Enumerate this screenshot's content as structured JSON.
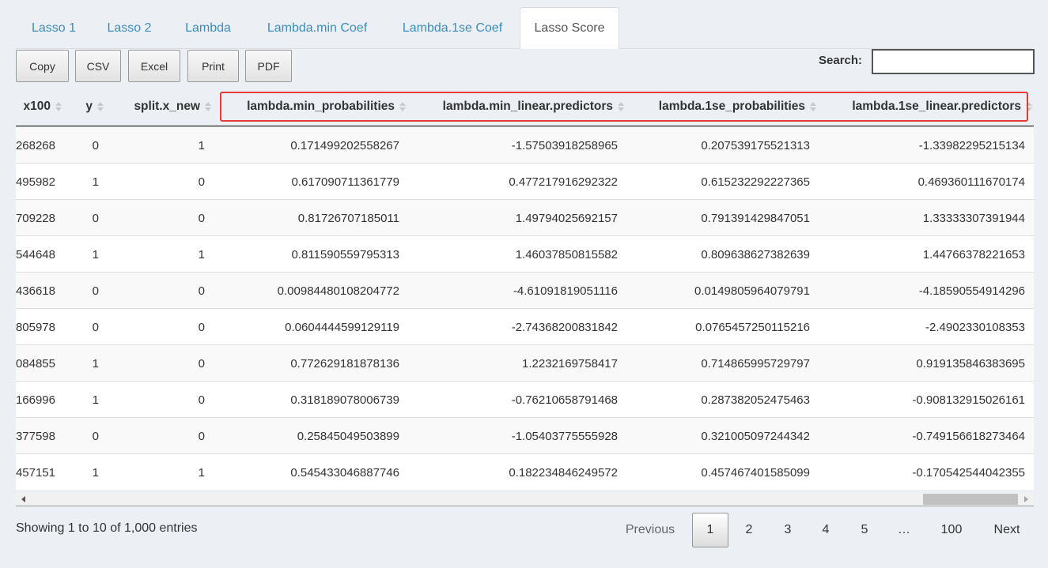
{
  "tabs": [
    {
      "label": "Lasso 1",
      "active": false
    },
    {
      "label": "Lasso 2",
      "active": false
    },
    {
      "label": "Lambda",
      "active": false
    },
    {
      "label": "Lambda.min Coef",
      "active": false
    },
    {
      "label": "Lambda.1se Coef",
      "active": false
    },
    {
      "label": "Lasso Score",
      "active": true
    }
  ],
  "buttons": {
    "copy": "Copy",
    "csv": "CSV",
    "excel": "Excel",
    "print": "Print",
    "pdf": "PDF"
  },
  "search": {
    "label": "Search:",
    "value": ""
  },
  "table": {
    "columns": [
      "x100",
      "y",
      "split.x_new",
      "lambda.min_probabilities",
      "lambda.min_linear.predictors",
      "lambda.1se_probabilities",
      "lambda.1se_linear.predictors"
    ],
    "rows": [
      [
        "268268",
        "0",
        "1",
        "0.171499202558267",
        "-1.57503918258965",
        "0.207539175521313",
        "-1.33982295215134"
      ],
      [
        "495982",
        "1",
        "0",
        "0.617090711361779",
        "0.477217916292322",
        "0.615232292227365",
        "0.469360111670174"
      ],
      [
        "709228",
        "0",
        "0",
        "0.81726707185011",
        "1.49794025692157",
        "0.791391429847051",
        "1.33333307391944"
      ],
      [
        "544648",
        "1",
        "1",
        "0.811590559795313",
        "1.46037850815582",
        "0.809638627382639",
        "1.44766378221653"
      ],
      [
        "436618",
        "0",
        "0",
        "0.00984480108204772",
        "-4.61091819051116",
        "0.0149805964079791",
        "-4.18590554914296"
      ],
      [
        "805978",
        "0",
        "0",
        "0.0604444599129119",
        "-2.74368200831842",
        "0.0765457250115216",
        "-2.4902330108353"
      ],
      [
        "084855",
        "1",
        "0",
        "0.772629181878136",
        "1.2232169758417",
        "0.714865995729797",
        "0.919135846383695"
      ],
      [
        "166996",
        "1",
        "0",
        "0.318189078006739",
        "-0.76210658791468",
        "0.287382052475463",
        "-0.908132915026161"
      ],
      [
        "377598",
        "0",
        "0",
        "0.25845049503899",
        "-1.05403775555928",
        "0.321005097244342",
        "-0.749156618273464"
      ],
      [
        "457151",
        "1",
        "1",
        "0.545433046887746",
        "0.182234846249572",
        "0.457467401585099",
        "-0.170542544042355"
      ]
    ]
  },
  "footer": {
    "info": "Showing 1 to 10 of 1,000 entries",
    "previous": "Previous",
    "pages": [
      "1",
      "2",
      "3",
      "4",
      "5",
      "…",
      "100"
    ],
    "next": "Next"
  },
  "colors": {
    "tab_link": "#3c8dbc",
    "highlight": "#e53935",
    "background": "#ecf0f5"
  }
}
